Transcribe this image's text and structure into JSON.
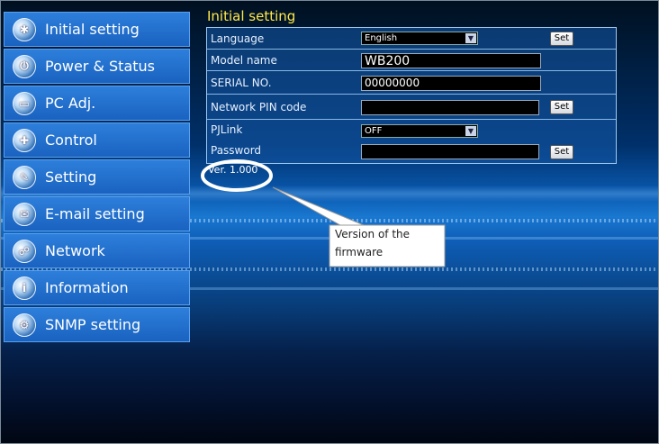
{
  "menu": {
    "items": [
      {
        "label": "Initial setting",
        "icon": "gear-icon",
        "glyph": "✱"
      },
      {
        "label": "Power & Status",
        "icon": "power-icon",
        "glyph": "⏻"
      },
      {
        "label": "PC Adj.",
        "icon": "monitor-icon",
        "glyph": "▭"
      },
      {
        "label": "Control",
        "icon": "control-icon",
        "glyph": "✚"
      },
      {
        "label": "Setting",
        "icon": "wrench-icon",
        "glyph": "✎"
      },
      {
        "label": "E-mail setting",
        "icon": "mail-icon",
        "glyph": "✉"
      },
      {
        "label": "Network",
        "icon": "network-icon",
        "glyph": "☍"
      },
      {
        "label": "Information",
        "icon": "info-icon",
        "glyph": "i"
      },
      {
        "label": "SNMP setting",
        "icon": "snmp-icon",
        "glyph": "⚙"
      }
    ]
  },
  "panel": {
    "title": "Initial setting",
    "language_label": "Language",
    "language_value": "English",
    "model_label": "Model name",
    "model_value": "WB200",
    "serial_label": "SERIAL NO.",
    "serial_value": "00000000",
    "pin_label": "Network PIN code",
    "pin_value": "",
    "pjlink_label": "PJLink",
    "pjlink_value": "OFF",
    "password_label": "Password",
    "password_value": "",
    "set_label": "Set"
  },
  "version": "Ver. 1.000",
  "callout": {
    "line1": "Version of the",
    "line2": "firmware"
  },
  "colors": {
    "title_yellow": "#ffe84a",
    "menu_blue": "#1f6fd0"
  }
}
